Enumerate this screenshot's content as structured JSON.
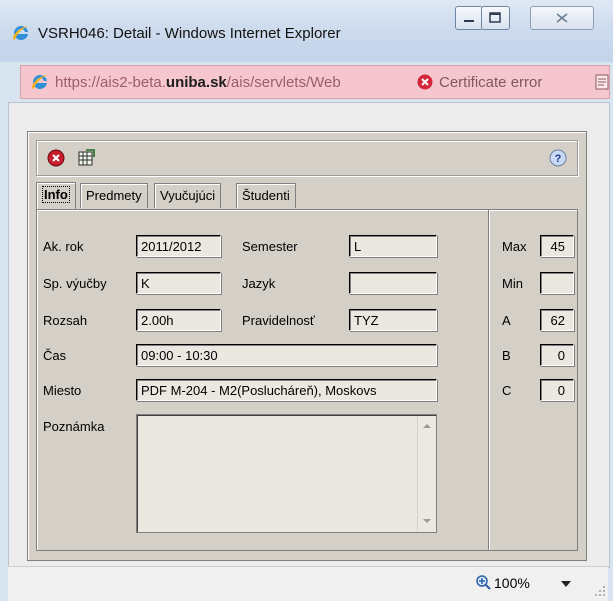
{
  "window": {
    "title": "VSRH046: Detail - Windows Internet Explorer"
  },
  "address": {
    "url_prefix": "https://ais2-beta.",
    "url_domain": "uniba.sk",
    "url_suffix": "/ais/servlets/Web",
    "certificate_text": "Certificate error"
  },
  "tabs": [
    {
      "label": "Info",
      "active": true
    },
    {
      "label": "Predmety",
      "active": false
    },
    {
      "label": "Vyučujúci",
      "active": false
    },
    {
      "label": "Študenti",
      "active": false
    }
  ],
  "form": {
    "ak_rok_label": "Ak. rok",
    "ak_rok_value": "2011/2012",
    "semester_label": "Semester",
    "semester_value": "L",
    "sp_vyucby_label": "Sp. výučby",
    "sp_vyucby_value": "K",
    "jazyk_label": "Jazyk",
    "jazyk_value": "",
    "rozsah_label": "Rozsah",
    "rozsah_value": "2.00h",
    "pravidelnost_label": "Pravidelnosť",
    "pravidelnost_value": "TYZ",
    "cas_label": "Čas",
    "cas_value": "09:00 - 10:30",
    "miesto_label": "Miesto",
    "miesto_value": "PDF M-204 - M2(Poslucháreň), Moskovs",
    "poznamka_label": "Poznámka",
    "poznamka_value": ""
  },
  "stats": {
    "max_label": "Max",
    "max_value": "45",
    "min_label": "Min",
    "min_value": "",
    "a_label": "A",
    "a_value": "62",
    "b_label": "B",
    "b_value": "0",
    "c_label": "C",
    "c_value": "0"
  },
  "status": {
    "zoom": "100%"
  },
  "colors": {
    "titlebar": "#cddbed",
    "addressbar_error": "#f6c6cf",
    "panel": "#d4d0c8"
  }
}
